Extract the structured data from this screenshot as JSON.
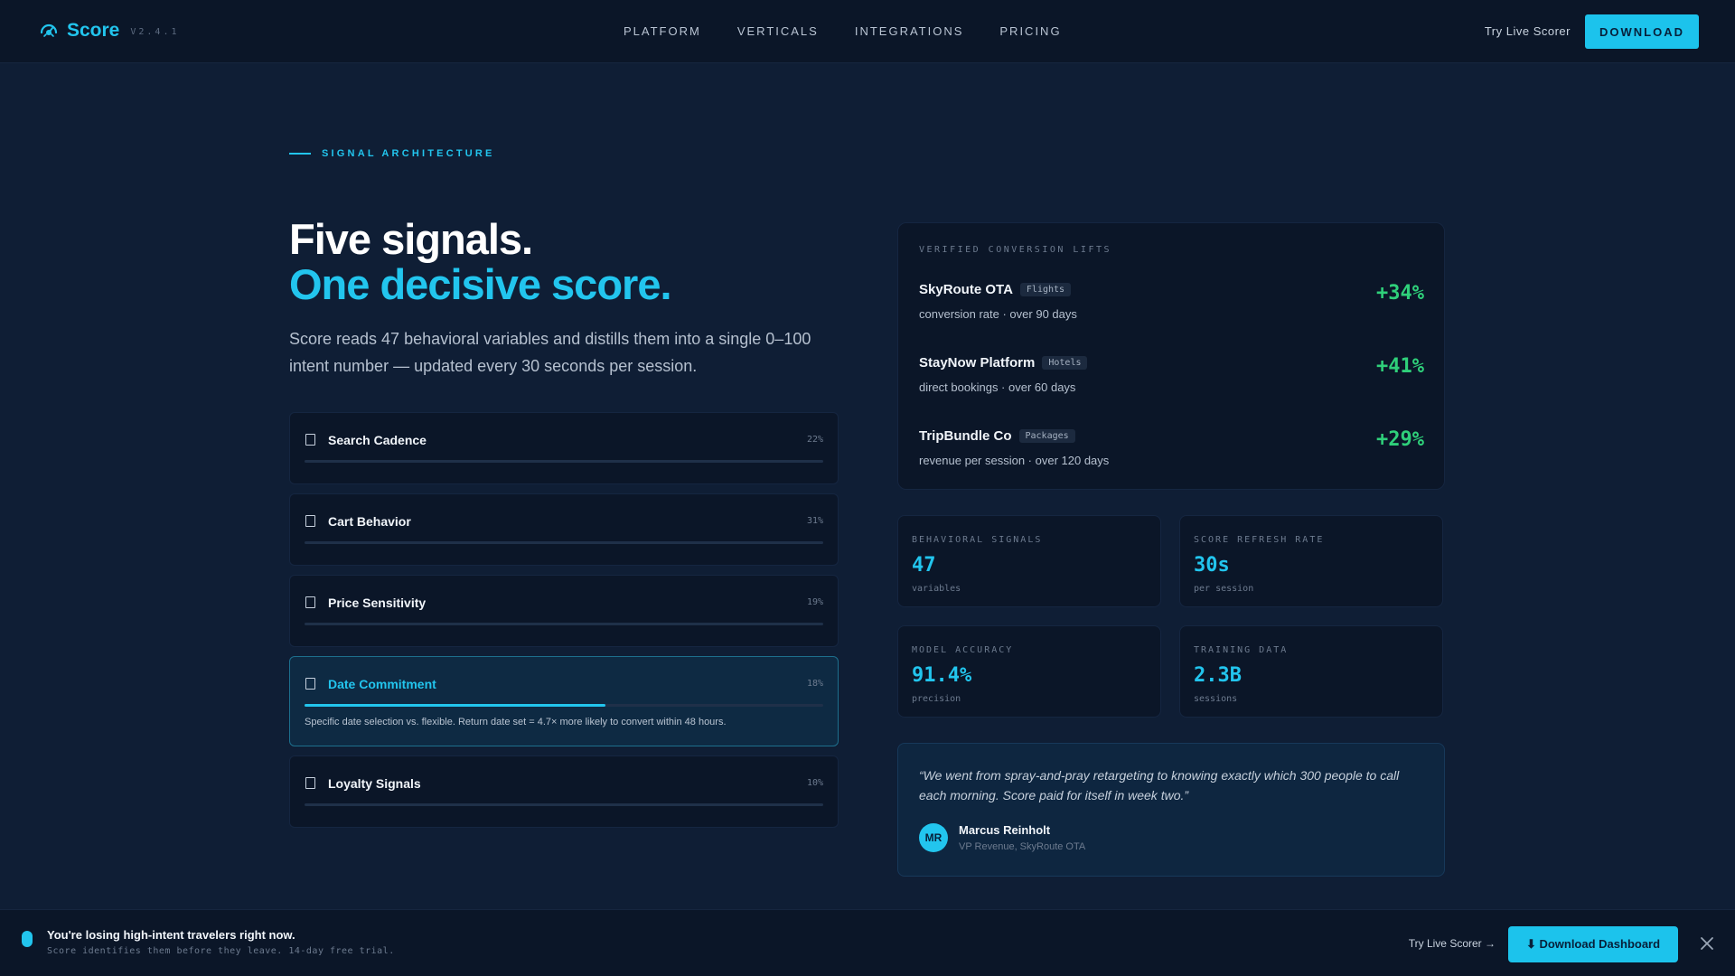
{
  "nav": {
    "brand": "Score",
    "version": "V2.4.1",
    "links": [
      "PLATFORM",
      "VERTICALS",
      "INTEGRATIONS",
      "PRICING"
    ],
    "try_label": "Try Live Scorer",
    "download_label": "DOWNLOAD",
    "logo_icon": "score-logo-icon"
  },
  "eyebrow": "SIGNAL ARCHITECTURE",
  "hero": {
    "line1": "Five signals.",
    "line2": "One decisive score.",
    "description": "Score reads 47 behavioral variables and distills them into a single 0–100 intent number — updated every 30 seconds per session."
  },
  "signals": [
    {
      "label": "Search Cadence",
      "pct": "22%",
      "fill": 0,
      "active": false
    },
    {
      "label": "Cart Behavior",
      "pct": "31%",
      "fill": 0,
      "active": false
    },
    {
      "label": "Price Sensitivity",
      "pct": "19%",
      "fill": 0,
      "active": false
    },
    {
      "label": "Date Commitment",
      "pct": "18%",
      "fill": 0.58,
      "active": true,
      "description": "Specific date selection vs. flexible. Return date set = 4.7× more likely to convert within 48 hours."
    },
    {
      "label": "Loyalty Signals",
      "pct": "10%",
      "fill": 0,
      "active": false
    }
  ],
  "lifts": {
    "title": "VERIFIED CONVERSION LIFTS",
    "rows": [
      {
        "company": "SkyRoute OTA",
        "tag": "Flights",
        "sub": "conversion rate · over 90 days",
        "value": "+34%"
      },
      {
        "company": "StayNow Platform",
        "tag": "Hotels",
        "sub": "direct bookings · over 60 days",
        "value": "+41%"
      },
      {
        "company": "TripBundle Co",
        "tag": "Packages",
        "sub": "revenue per session · over 120 days",
        "value": "+29%"
      }
    ]
  },
  "stats": [
    {
      "label": "BEHAVIORAL SIGNALS",
      "value": "47",
      "sub": "variables"
    },
    {
      "label": "SCORE REFRESH RATE",
      "value": "30s",
      "sub": "per session"
    },
    {
      "label": "MODEL ACCURACY",
      "value": "91.4%",
      "sub": "precision"
    },
    {
      "label": "TRAINING DATA",
      "value": "2.3B",
      "sub": "sessions"
    }
  ],
  "testimonial": {
    "quote": "“We went from spray-and-pray retargeting to knowing exactly which 300 people to call each morning. Score paid for itself in week two.”",
    "initials": "MR",
    "name": "Marcus Reinholt",
    "role": "VP Revenue, SkyRoute OTA"
  },
  "banner": {
    "title": "You're losing high-intent travelers right now.",
    "subtitle": "Score identifies them before they leave. 14-day free trial.",
    "try_label": "Try Live Scorer →",
    "download_label": "⬇ Download Dashboard",
    "close_icon": "close-icon"
  },
  "colors": {
    "background": "#0f1e35",
    "accent": "#22c5ee",
    "positive": "#2fd07a",
    "card": "#0b1628"
  }
}
